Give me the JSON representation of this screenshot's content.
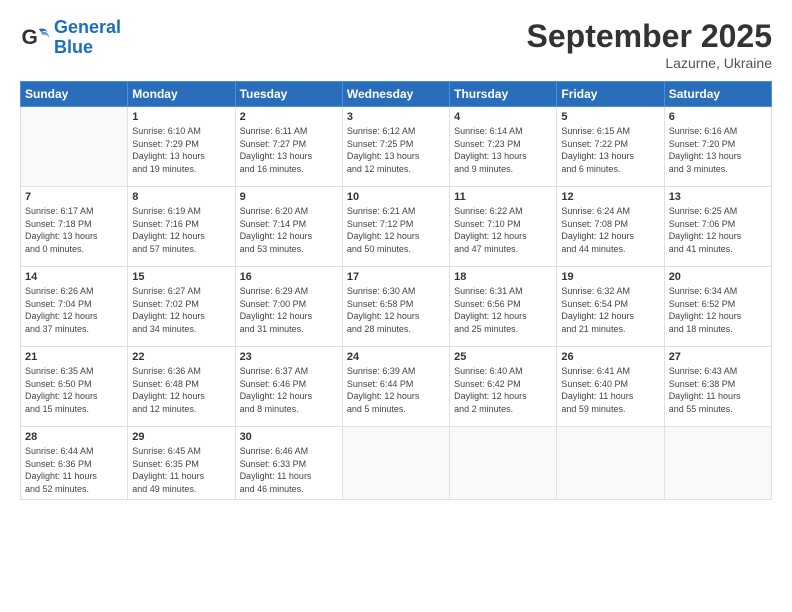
{
  "logo": {
    "line1": "General",
    "line2": "Blue"
  },
  "title": "September 2025",
  "subtitle": "Lazurne, Ukraine",
  "days_header": [
    "Sunday",
    "Monday",
    "Tuesday",
    "Wednesday",
    "Thursday",
    "Friday",
    "Saturday"
  ],
  "weeks": [
    [
      {
        "day": "",
        "info": ""
      },
      {
        "day": "1",
        "info": "Sunrise: 6:10 AM\nSunset: 7:29 PM\nDaylight: 13 hours\nand 19 minutes."
      },
      {
        "day": "2",
        "info": "Sunrise: 6:11 AM\nSunset: 7:27 PM\nDaylight: 13 hours\nand 16 minutes."
      },
      {
        "day": "3",
        "info": "Sunrise: 6:12 AM\nSunset: 7:25 PM\nDaylight: 13 hours\nand 12 minutes."
      },
      {
        "day": "4",
        "info": "Sunrise: 6:14 AM\nSunset: 7:23 PM\nDaylight: 13 hours\nand 9 minutes."
      },
      {
        "day": "5",
        "info": "Sunrise: 6:15 AM\nSunset: 7:22 PM\nDaylight: 13 hours\nand 6 minutes."
      },
      {
        "day": "6",
        "info": "Sunrise: 6:16 AM\nSunset: 7:20 PM\nDaylight: 13 hours\nand 3 minutes."
      }
    ],
    [
      {
        "day": "7",
        "info": "Sunrise: 6:17 AM\nSunset: 7:18 PM\nDaylight: 13 hours\nand 0 minutes."
      },
      {
        "day": "8",
        "info": "Sunrise: 6:19 AM\nSunset: 7:16 PM\nDaylight: 12 hours\nand 57 minutes."
      },
      {
        "day": "9",
        "info": "Sunrise: 6:20 AM\nSunset: 7:14 PM\nDaylight: 12 hours\nand 53 minutes."
      },
      {
        "day": "10",
        "info": "Sunrise: 6:21 AM\nSunset: 7:12 PM\nDaylight: 12 hours\nand 50 minutes."
      },
      {
        "day": "11",
        "info": "Sunrise: 6:22 AM\nSunset: 7:10 PM\nDaylight: 12 hours\nand 47 minutes."
      },
      {
        "day": "12",
        "info": "Sunrise: 6:24 AM\nSunset: 7:08 PM\nDaylight: 12 hours\nand 44 minutes."
      },
      {
        "day": "13",
        "info": "Sunrise: 6:25 AM\nSunset: 7:06 PM\nDaylight: 12 hours\nand 41 minutes."
      }
    ],
    [
      {
        "day": "14",
        "info": "Sunrise: 6:26 AM\nSunset: 7:04 PM\nDaylight: 12 hours\nand 37 minutes."
      },
      {
        "day": "15",
        "info": "Sunrise: 6:27 AM\nSunset: 7:02 PM\nDaylight: 12 hours\nand 34 minutes."
      },
      {
        "day": "16",
        "info": "Sunrise: 6:29 AM\nSunset: 7:00 PM\nDaylight: 12 hours\nand 31 minutes."
      },
      {
        "day": "17",
        "info": "Sunrise: 6:30 AM\nSunset: 6:58 PM\nDaylight: 12 hours\nand 28 minutes."
      },
      {
        "day": "18",
        "info": "Sunrise: 6:31 AM\nSunset: 6:56 PM\nDaylight: 12 hours\nand 25 minutes."
      },
      {
        "day": "19",
        "info": "Sunrise: 6:32 AM\nSunset: 6:54 PM\nDaylight: 12 hours\nand 21 minutes."
      },
      {
        "day": "20",
        "info": "Sunrise: 6:34 AM\nSunset: 6:52 PM\nDaylight: 12 hours\nand 18 minutes."
      }
    ],
    [
      {
        "day": "21",
        "info": "Sunrise: 6:35 AM\nSunset: 6:50 PM\nDaylight: 12 hours\nand 15 minutes."
      },
      {
        "day": "22",
        "info": "Sunrise: 6:36 AM\nSunset: 6:48 PM\nDaylight: 12 hours\nand 12 minutes."
      },
      {
        "day": "23",
        "info": "Sunrise: 6:37 AM\nSunset: 6:46 PM\nDaylight: 12 hours\nand 8 minutes."
      },
      {
        "day": "24",
        "info": "Sunrise: 6:39 AM\nSunset: 6:44 PM\nDaylight: 12 hours\nand 5 minutes."
      },
      {
        "day": "25",
        "info": "Sunrise: 6:40 AM\nSunset: 6:42 PM\nDaylight: 12 hours\nand 2 minutes."
      },
      {
        "day": "26",
        "info": "Sunrise: 6:41 AM\nSunset: 6:40 PM\nDaylight: 11 hours\nand 59 minutes."
      },
      {
        "day": "27",
        "info": "Sunrise: 6:43 AM\nSunset: 6:38 PM\nDaylight: 11 hours\nand 55 minutes."
      }
    ],
    [
      {
        "day": "28",
        "info": "Sunrise: 6:44 AM\nSunset: 6:36 PM\nDaylight: 11 hours\nand 52 minutes."
      },
      {
        "day": "29",
        "info": "Sunrise: 6:45 AM\nSunset: 6:35 PM\nDaylight: 11 hours\nand 49 minutes."
      },
      {
        "day": "30",
        "info": "Sunrise: 6:46 AM\nSunset: 6:33 PM\nDaylight: 11 hours\nand 46 minutes."
      },
      {
        "day": "",
        "info": ""
      },
      {
        "day": "",
        "info": ""
      },
      {
        "day": "",
        "info": ""
      },
      {
        "day": "",
        "info": ""
      }
    ]
  ]
}
